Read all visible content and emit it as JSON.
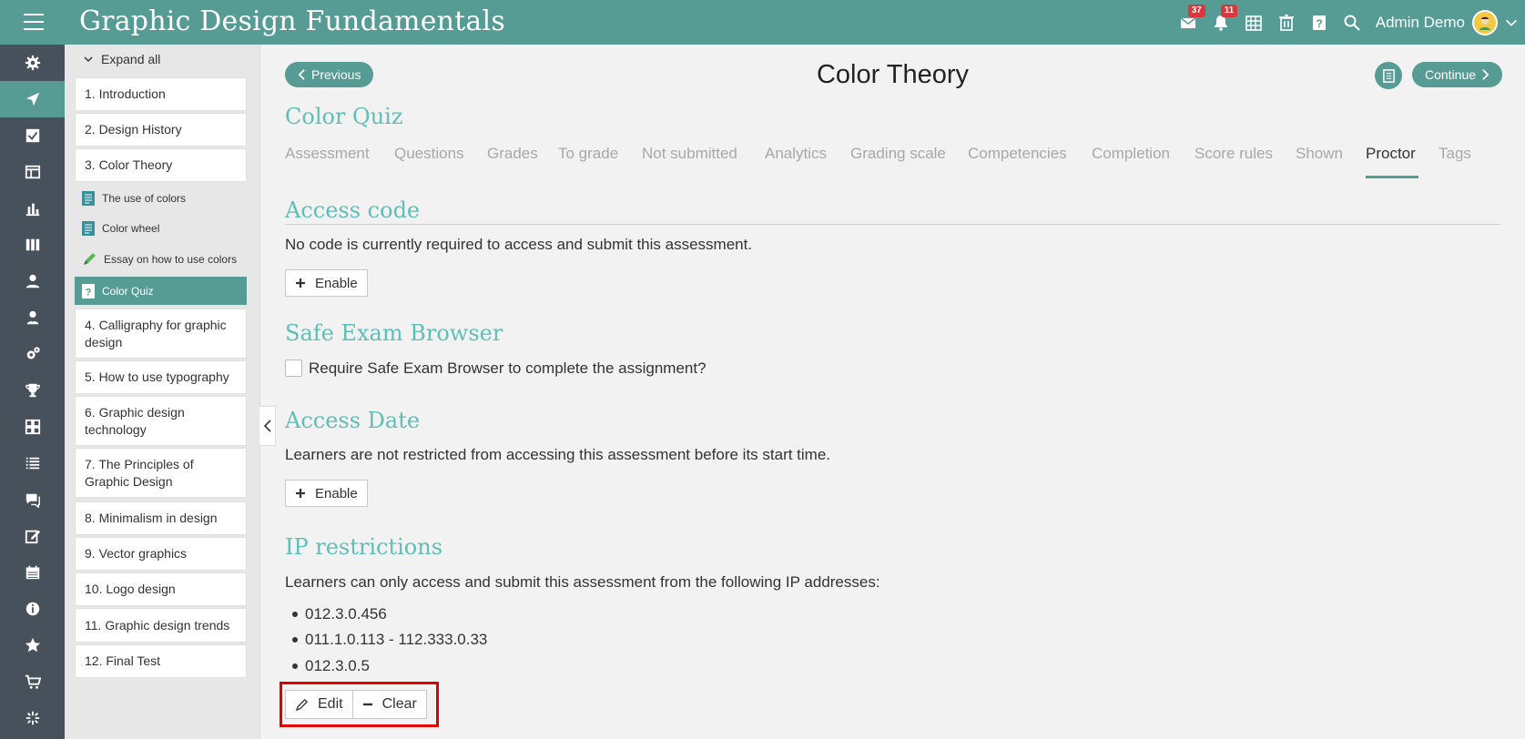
{
  "header": {
    "title": "Graphic Design Fundamentals",
    "messages_badge": "37",
    "notifications_badge": "11",
    "user_name": "Admin Demo"
  },
  "rail": {
    "items": [
      "gear-icon",
      "navigation-icon",
      "check-icon",
      "layout-icon",
      "chart-icon",
      "books-icon",
      "user-icon",
      "users-icon",
      "cogs-icon",
      "trophy-icon",
      "grid-icon",
      "list-icon",
      "chat-icon",
      "edit-icon",
      "calendar-icon",
      "info-icon",
      "star-icon",
      "cart-icon",
      "sparkle-icon"
    ]
  },
  "outline": {
    "expand_all": "Expand all",
    "units": [
      "1. Introduction",
      "2. Design History",
      "3. Color Theory",
      "4. Calligraphy for graphic design",
      "5. How to use typography",
      "6. Graphic design technology",
      "7. The Principles of Graphic Design",
      "8. Minimalism in design",
      "9. Vector graphics",
      "10. Logo design",
      "11. Graphic design trends",
      "12. Final Test"
    ],
    "subitems": [
      "The use of colors",
      "Color wheel",
      "Essay on how to use colors",
      "Color Quiz"
    ]
  },
  "main": {
    "previous_label": "Previous",
    "page_title": "Color Theory",
    "continue_label": "Continue",
    "quiz_title": "Color Quiz",
    "tabs": [
      "Assessment",
      "Questions",
      "Grades",
      "To grade",
      "Not submitted",
      "Analytics",
      "Grading scale",
      "Competencies",
      "Completion",
      "Score rules",
      "Shown",
      "Proctor",
      "Tags"
    ],
    "active_tab": "Proctor",
    "access_code": {
      "title": "Access code",
      "text": "No code is currently required to access and submit this assessment.",
      "button": "Enable"
    },
    "seb": {
      "title": "Safe Exam Browser",
      "checkbox_label": "Require Safe Exam Browser to complete the assignment?"
    },
    "access_date": {
      "title": "Access Date",
      "text": "Learners are not restricted from accessing this assessment before its start time.",
      "button": "Enable"
    },
    "ip": {
      "title": "IP restrictions",
      "text": "Learners can only access and submit this assessment from the following IP addresses:",
      "addresses": [
        "012.3.0.456",
        "011.1.0.113 - 112.333.0.33",
        "012.3.0.5"
      ],
      "edit_label": "Edit",
      "clear_label": "Clear"
    }
  }
}
